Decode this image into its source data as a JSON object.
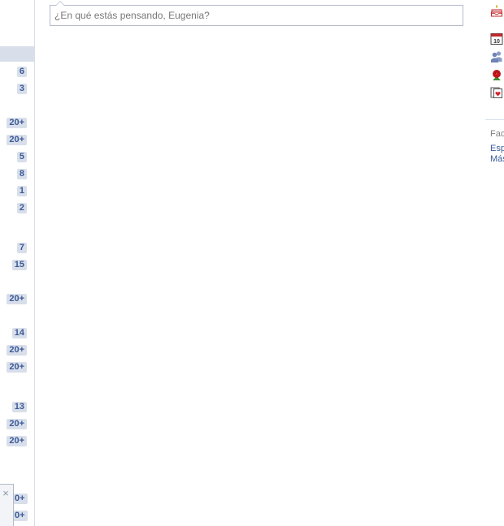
{
  "composer": {
    "placeholder": "¿En qué estás pensando, Eugenia?"
  },
  "left_sidebar": {
    "counts": [
      "6",
      "3",
      "20+",
      "20+",
      "5",
      "8",
      "1",
      "2",
      "7",
      "15",
      "20+",
      "14",
      "20+",
      "20+",
      "13",
      "20+",
      "20+"
    ],
    "clipped_counts": [
      "0+",
      "0+"
    ]
  },
  "right_sidebar": {
    "icons": [
      "birthday-cake-icon",
      "calendar-icon",
      "friends-icon",
      "rose-gift-icon",
      "heart-card-icon"
    ],
    "calendar_day": "10",
    "footer_title": "Fac",
    "footer_links": [
      "Esp",
      "Más"
    ]
  },
  "colors": {
    "link_blue": "#3b5998",
    "badge_bg": "#d8dfea",
    "border": "#b4bbcd"
  }
}
